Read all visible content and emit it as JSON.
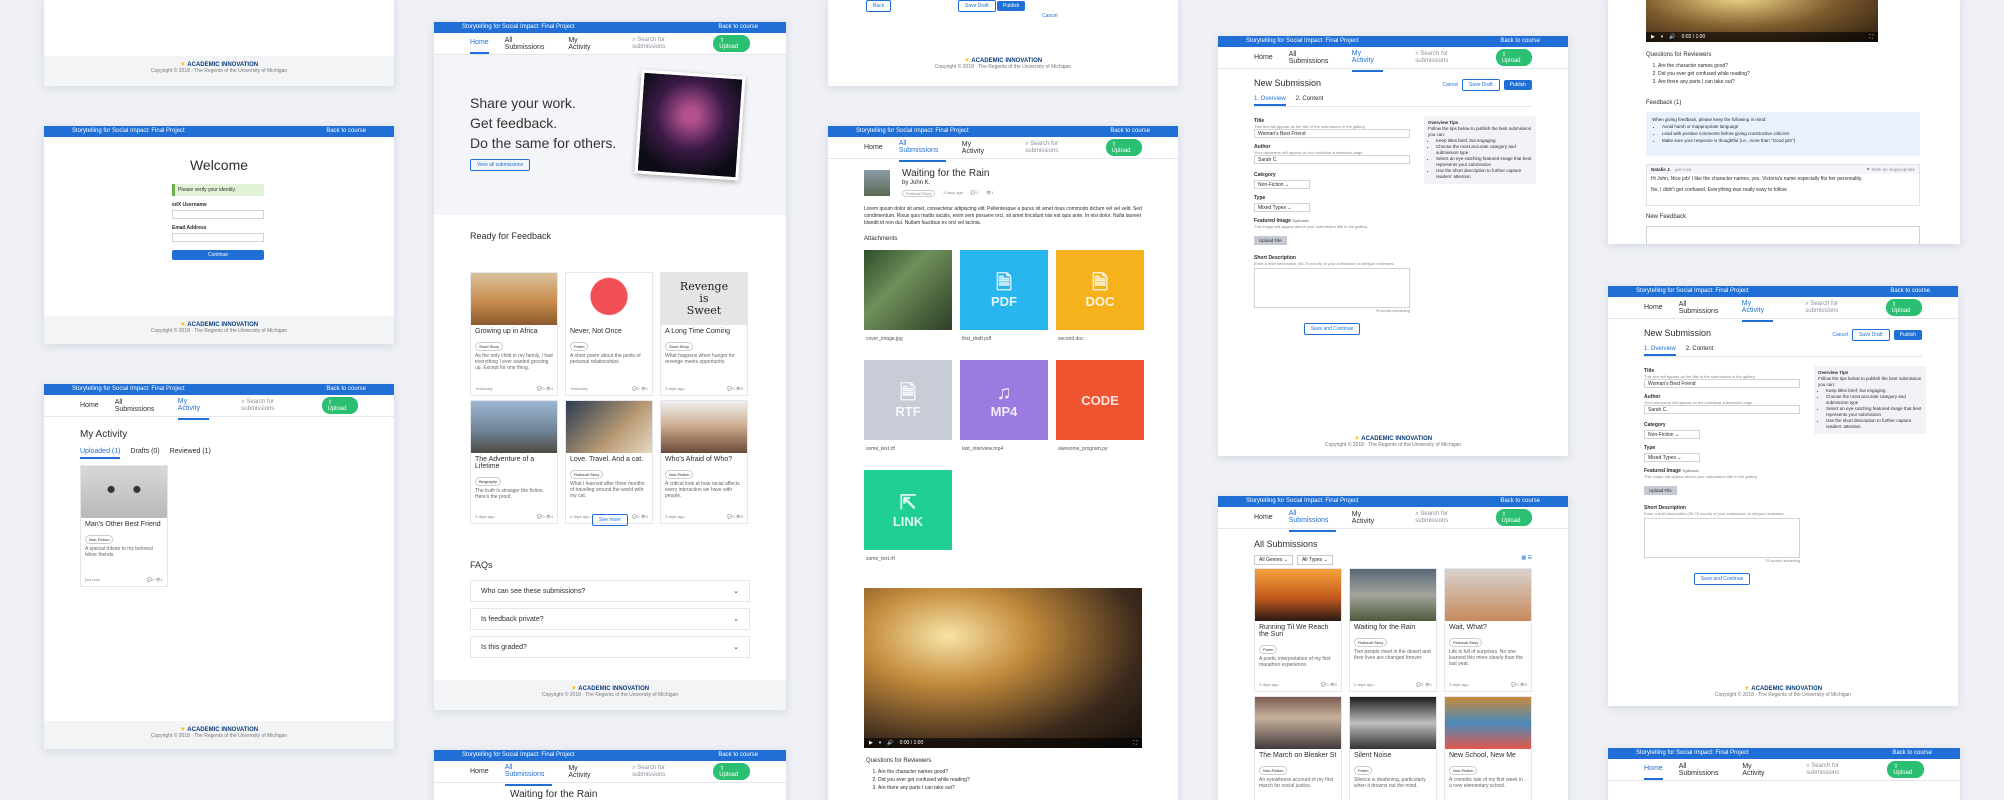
{
  "brand": {
    "project": "Storytelling for Social Impact: Final Project",
    "back": "Back to course",
    "logo_a": "ACADEMIC",
    "logo_b": "INNOVATION",
    "copyright": "Copyright © 2018 · The Regents of the University of Michigan"
  },
  "nav": {
    "home": "Home",
    "all": "All Submissions",
    "mine": "My Activity",
    "search": "Search for submissions",
    "upload": "Upload"
  },
  "welcome": {
    "title": "Welcome",
    "notice": "Please verify your identity.",
    "user_label": "edX Username",
    "email_label": "Email Address",
    "continue": "Continue"
  },
  "activity": {
    "title": "My Activity",
    "tabs": [
      "Uploaded (1)",
      "Drafts (0)",
      "Reviewed (1)"
    ],
    "card": {
      "title": "Man's Other Best Friend",
      "tag": "Non-Fiction",
      "desc": "A special tribute to my beloved feline friends.",
      "time": "just now",
      "comments": "0",
      "views": "1"
    }
  },
  "home": {
    "hero": [
      "Share your work.",
      "Get feedback.",
      "Do the same for others."
    ],
    "view_all": "View all submissions",
    "ready": "Ready for Feedback",
    "see_more": "See more",
    "faqs": "FAQs",
    "faq_items": [
      "Who can see these submissions?",
      "Is feedback private?",
      "Is this graded?"
    ],
    "cards": [
      {
        "title": "Growing up in Africa",
        "tag": "Short Story",
        "desc": "As the only child in my family, I had everything I ever wanted growing up. Except for one thing.",
        "time": "Yesterday",
        "c": "0",
        "v": "4"
      },
      {
        "title": "Never, Not Once",
        "tag": "Poem",
        "desc": "A short poem about the perils of personal relationships.",
        "time": "Yesterday",
        "c": "0",
        "v": "1"
      },
      {
        "title": "A Long Time Coming",
        "tag": "Short Story",
        "desc": "What happens when hunger for revenge meets opportunity.",
        "time": "3 days ago",
        "c": "0",
        "v": "0"
      },
      {
        "title": "The Adventure of a Lifetime",
        "tag": "Biography",
        "desc": "The truth is stranger the fiction. Here's the proof.",
        "time": "3 days ago",
        "c": "0",
        "v": "4"
      },
      {
        "title": "Love. Travel. And a cat.",
        "tag": "Fictional Story",
        "desc": "What I learned after three months of traveling around the world with my cat.",
        "time": "4 days ago",
        "c": "0",
        "v": "3"
      },
      {
        "title": "Who's Afraid of Who?",
        "tag": "Non-Fiction",
        "desc": "A critical look at how racial affects every interaction we have with people.",
        "time": "3 days ago",
        "c": "0",
        "v": "0"
      }
    ]
  },
  "revenge": [
    "Revenge",
    "is",
    "Sweet"
  ],
  "review_top": {
    "draft": "Save Draft",
    "publish": "Publish",
    "back": "Back",
    "cancel": "Cancel"
  },
  "detail": {
    "title": "Waiting for the Rain",
    "by": "by John K.",
    "tag": "Fictional Story",
    "time": "2 days ago",
    "comments": "1",
    "views": "1",
    "body": "Lorem ipsum dolor sit amet, consectetur adipiscing elit. Pellentesque a purus sit amet risus commodo dictum vel vel velit. Sed condimentum. Risus quis mattis iaculis, enim sem posuere orci, sit amet tincidunt nisi est quis ante. In nisi dolor. Nulla laoreet blandit id non dui. Nullam faucibus ex orci vel lacinia.",
    "attach": "Attachments",
    "files": [
      {
        "name": "cover_image.jpg",
        "type": "img"
      },
      {
        "name": "first_draft.pdf",
        "type": "PDF"
      },
      {
        "name": "second.doc",
        "type": "DOC"
      },
      {
        "name": "some_text.rtf",
        "type": "RTF"
      },
      {
        "name": "last_interview.mp4",
        "type": "MP4"
      },
      {
        "name": "awesome_program.py",
        "type": "CODE"
      },
      {
        "name": "some_text.rtf",
        "type": "LINK"
      }
    ],
    "video_time": "0:00 / 1:00",
    "q_title": "Questions for Reviewers",
    "questions": [
      "Are the character names good?",
      "Did you ever get confused while reading?",
      "Are there any parts I can take out?"
    ]
  },
  "new": {
    "title": "New Submission",
    "tabs": [
      "1. Overview",
      "2. Content"
    ],
    "cancel": "Cancel",
    "draft": "Save Draft",
    "publish": "Publish",
    "title_label": "Title",
    "title_hint": "This text will appear as the title of the submission in the gallery.",
    "title_val": "Woman's Best Friend",
    "author_label": "Author",
    "author_hint": "Your username will appear on the individual submission page.",
    "author_val": "Sarah C.",
    "cat_label": "Category",
    "cat_val": "Non-Fiction",
    "type_label": "Type",
    "type_val": "Mixed Types",
    "feat_label": "Featured Image",
    "optional": "Optional",
    "feat_hint": "This image will appear above your submission title in the gallery.",
    "upload_file": "Upload File",
    "desc_label": "Short Description",
    "desc_hint": "Enter a brief description (50-75 words) of your submission to intrigue reviewers.",
    "remaining": "75 words remaining",
    "save_continue": "Save and Continue",
    "tips_title": "Overview Tips",
    "tips_intro": "Follow the tips below to publish the best submission you can:",
    "tips": [
      "Keep titles brief, but engaging",
      "Choose the most accurate category and submission type",
      "Select an eye-catching featured image that best represents your submission",
      "Use the short description to further capture readers' attention"
    ]
  },
  "gallery": {
    "title": "All Submissions",
    "genres": "All Genres",
    "types": "All Types",
    "cards": [
      {
        "title": "Running Til We Reach the Sun",
        "tag": "Poem",
        "desc": "A poetic interpretation of my first marathon experience.",
        "time": "3 days ago",
        "c": "0",
        "v": "0"
      },
      {
        "title": "Waiting for the Rain",
        "tag": "Fictional Story",
        "desc": "Two people meet in the desert and their lives are changed forever.",
        "time": "2 days ago",
        "c": "1",
        "v": "1"
      },
      {
        "title": "Wait, What?",
        "tag": "Fictional Story",
        "desc": "Life is full of surprises. No one learned this more clearly than the last year.",
        "time": "3 days ago",
        "c": "0",
        "v": "0"
      },
      {
        "title": "The March on Bleaker St",
        "tag": "Non-Fiction",
        "desc": "An eyewitness account of my first march for social justice.",
        "time": "",
        "c": "",
        "v": ""
      },
      {
        "title": "Silent Noise",
        "tag": "Poem",
        "desc": "Silence is deafening, particularly when it drowns out the mind.",
        "time": "",
        "c": "",
        "v": ""
      },
      {
        "title": "New School, New Me",
        "tag": "Non-Fiction",
        "desc": "A comedic tale of my first week in a new elementary school.",
        "time": "",
        "c": "",
        "v": ""
      }
    ]
  },
  "feedback": {
    "q_title": "Questions for Reviewers",
    "questions": [
      "Are the character names good?",
      "Did you ever get confused while reading?",
      "Are there any parts I can take out?"
    ],
    "fb_title": "Feedback (1)",
    "guide_intro": "When giving feedback, please keep the following in mind:",
    "guide": [
      "Avoid harsh or inappropriate language",
      "Lead with positive comments before giving constructive criticism",
      "Make sure your response is thoughtful (i.e., more than \"Good job!\")"
    ],
    "author": "Natalie J.",
    "time": "· just now",
    "flag": "Mark as inappropriate",
    "comment": "Hi John, Nice job! I like the character names, yes. Victoria's name especially fits her personality.",
    "reply": "No, I didn't get confused. Everything was really easy to follow.",
    "new_fb": "New Feedback",
    "video_time": "0:02 / 1:00"
  },
  "colors": {
    "accent": "#1f6fd6",
    "upload": "#2bbf72",
    "pdf": "#29b6ee",
    "doc": "#f6b21c",
    "rtf": "#c8ccd6",
    "mp4": "#9b7be0",
    "code": "#ee5430",
    "link": "#1fcf95"
  }
}
